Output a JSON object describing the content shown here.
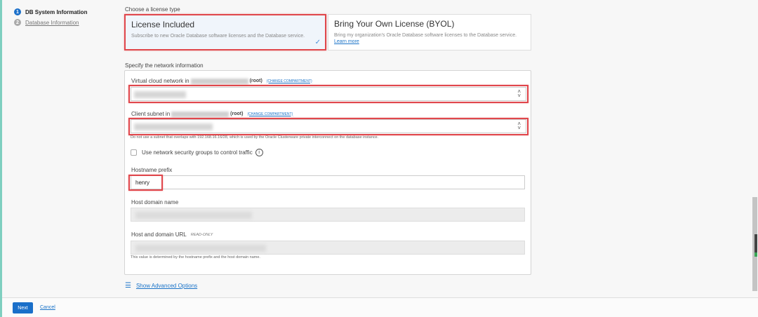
{
  "steps": [
    {
      "num": "1",
      "label": "DB System Information"
    },
    {
      "num": "2",
      "label": "Database Information"
    }
  ],
  "license": {
    "heading": "Choose a license type",
    "options": [
      {
        "title": "License Included",
        "desc": "Subscribe to new Oracle Database software licenses and the Database service.",
        "selected": true
      },
      {
        "title": "Bring Your Own License (BYOL)",
        "desc": "Bring my organization's Oracle Database software licenses to the Database service.",
        "link": "Learn more"
      }
    ]
  },
  "network": {
    "heading": "Specify the network information",
    "vcn": {
      "label": "Virtual cloud network in",
      "root": "(root)",
      "change": "(CHANGE COMPARTMENT)"
    },
    "subnet": {
      "label": "Client subnet in",
      "root": "(root)",
      "change": "(CHANGE COMPARTMENT)",
      "help": "Do not use a subnet that overlaps with 192.168.16.16/28, which is used by the Oracle Clusterware private interconnect on the database instance."
    },
    "nsg": {
      "label": "Use network security groups to control traffic",
      "checked": false
    },
    "hostname": {
      "label": "Hostname prefix",
      "value": "henry"
    },
    "domain": {
      "label": "Host domain name"
    },
    "url": {
      "label": "Host and domain URL",
      "badge": "READ-ONLY",
      "help": "This value is determined by the hostname prefix and the host domain name."
    }
  },
  "advanced": "Show Advanced Options",
  "footer": {
    "next": "Next",
    "cancel": "Cancel"
  },
  "colors": {
    "accent": "#1a73c8",
    "highlight": "#e0474c",
    "selected_bg": "#f0f5fb"
  }
}
